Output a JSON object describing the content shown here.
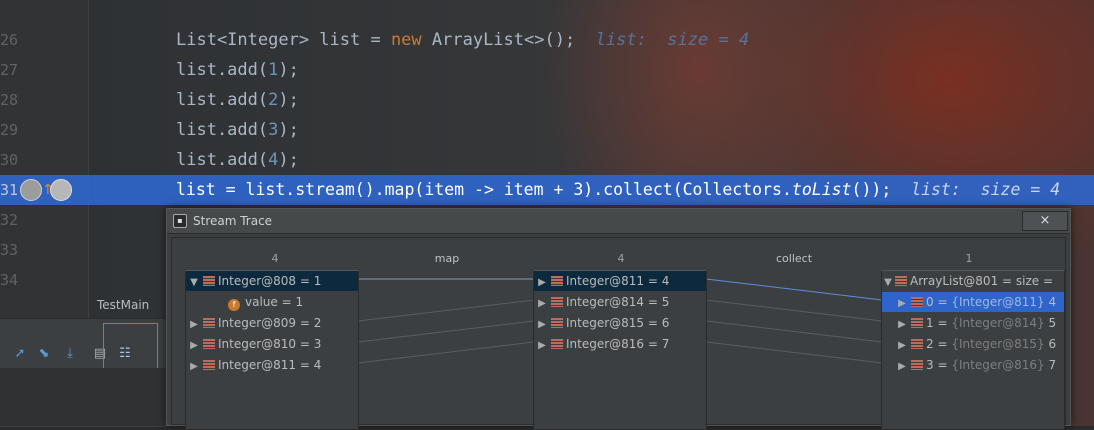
{
  "editor": {
    "line_numbers": [
      "26",
      "27",
      "28",
      "29",
      "30",
      "31",
      "32",
      "33",
      "34"
    ],
    "line26": {
      "a": "List<Integer> list = ",
      "kw": "new",
      "b": " ArrayList<>();",
      "hint": "  list:  size = 4"
    },
    "line27": {
      "a": "list.add(",
      "n": "1",
      "b": ");"
    },
    "line28": {
      "a": "list.add(",
      "n": "2",
      "b": ");"
    },
    "line29": {
      "a": "list.add(",
      "n": "3",
      "b": ");"
    },
    "line30": {
      "a": "list.add(",
      "n": "4",
      "b": ");"
    },
    "line31": {
      "a": "list = list.stream().map(item -> item + 3).collect(Collectors.",
      "it": "toList",
      "b": "());",
      "hint": "  list:  size = 4"
    }
  },
  "tool_window": {
    "tab_label": "TestMain"
  },
  "dialog": {
    "title": "Stream Trace",
    "close_label": "×",
    "columns": [
      {
        "count": "4"
      },
      {
        "label": "map"
      },
      {
        "count": "4"
      },
      {
        "label": "collect"
      },
      {
        "count": "1"
      }
    ],
    "left": [
      {
        "label": "Integer@808 = 1",
        "expanded": true
      },
      {
        "label": "value = 1",
        "child": true
      },
      {
        "label": "Integer@809 = 2"
      },
      {
        "label": "Integer@810 = 3"
      },
      {
        "label": "Integer@811 = 4"
      }
    ],
    "middle": [
      {
        "label": "Integer@811 = 4"
      },
      {
        "label": "Integer@814 = 5"
      },
      {
        "label": "Integer@815 = 6"
      },
      {
        "label": "Integer@816 = 7"
      }
    ],
    "right": {
      "root": "ArrayList@801 =  size =",
      "items": [
        {
          "key": "0 = ",
          "ref": "{Integer@811}",
          "val": " 4"
        },
        {
          "key": "1 = ",
          "ref": "{Integer@814}",
          "val": " 5"
        },
        {
          "key": "2 = ",
          "ref": "{Integer@815}",
          "val": " 6"
        },
        {
          "key": "3 = ",
          "ref": "{Integer@816}",
          "val": " 7"
        }
      ]
    },
    "icons": {
      "field_badge": "f"
    }
  },
  "colors": {
    "highlight": "#2f65ca",
    "keyword": "#cc7832",
    "number": "#6897bb",
    "hint": "#56749a"
  }
}
